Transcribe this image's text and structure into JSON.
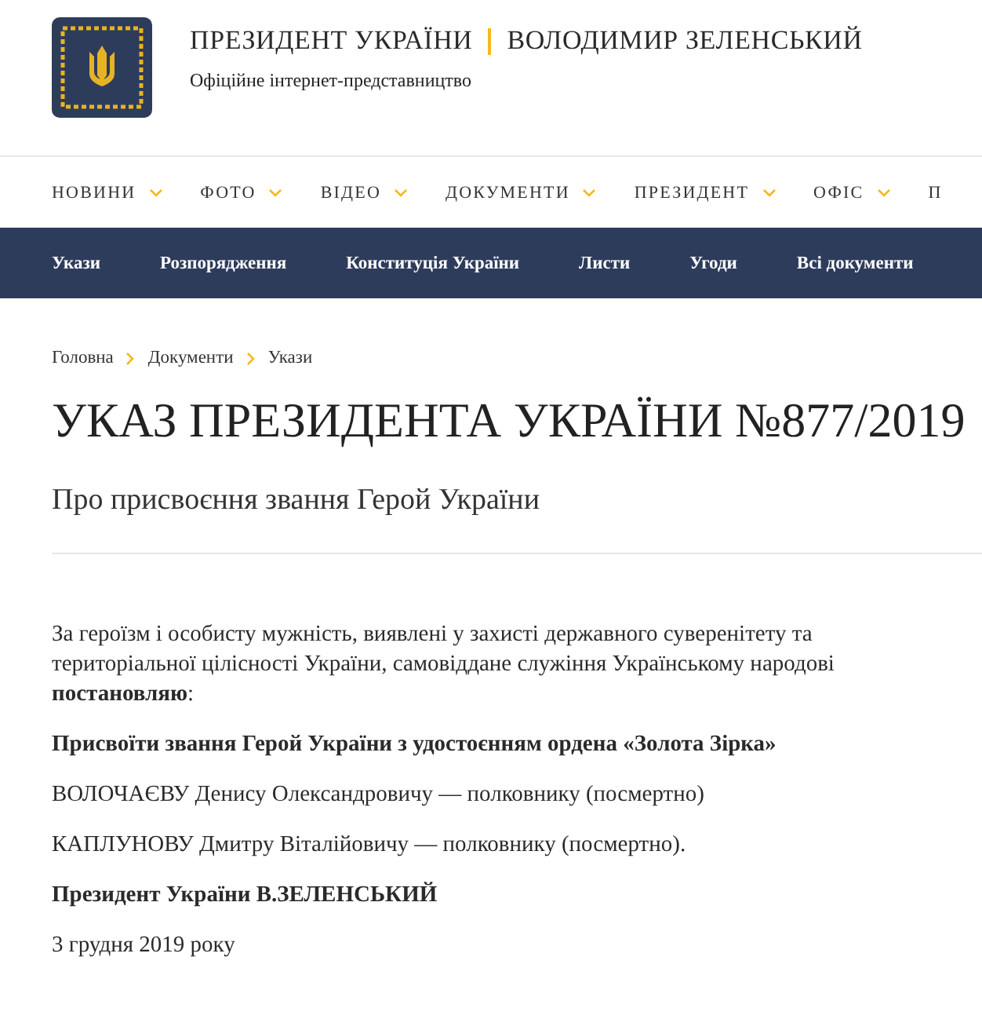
{
  "header": {
    "title": "ПРЕЗИДЕНТ УКРАЇНИ",
    "name": "ВОЛОДИМИР ЗЕЛЕНСЬКИЙ",
    "subtitle": "Офіційне інтернет-представництво"
  },
  "main_nav": [
    {
      "label": "НОВИНИ",
      "has_menu": true
    },
    {
      "label": "ФОТО",
      "has_menu": true
    },
    {
      "label": "ВІДЕО",
      "has_menu": true
    },
    {
      "label": "ДОКУМЕНТИ",
      "has_menu": true
    },
    {
      "label": "ПРЕЗИДЕНТ",
      "has_menu": true
    },
    {
      "label": "ОФІС",
      "has_menu": true
    },
    {
      "label": "П",
      "has_menu": false
    }
  ],
  "sub_nav": [
    "Укази",
    "Розпорядження",
    "Конституція України",
    "Листи",
    "Угоди",
    "Всі документи"
  ],
  "breadcrumbs": [
    "Головна",
    "Документи",
    "Укази"
  ],
  "document": {
    "title": "УКАЗ ПРЕЗИДЕНТА УКРАЇНИ №877/2019",
    "subtitle": "Про присвоєння звання Герой України",
    "paragraphs": [
      {
        "kind": "plain",
        "text": "За героїзм і особисту мужність, виявлені у захисті державного суверенітету та територіальної цілісності України, самовіддане служіння Українському народові **постановляю**:"
      },
      {
        "kind": "bold",
        "text": "Присвоїти звання Герой України з удостоєнням ордена «Золота Зірка»"
      },
      {
        "kind": "plain",
        "text": "ВОЛОЧАЄВУ Денису Олександровичу — полковнику (посмертно)"
      },
      {
        "kind": "plain",
        "text": "КАПЛУНОВУ Дмитру Віталійовичу — полковнику (посмертно)."
      },
      {
        "kind": "bold",
        "text": "Президент України В.ЗЕЛЕНСЬКИЙ"
      },
      {
        "kind": "plain",
        "text": "3 грудня 2019 року"
      }
    ]
  }
}
